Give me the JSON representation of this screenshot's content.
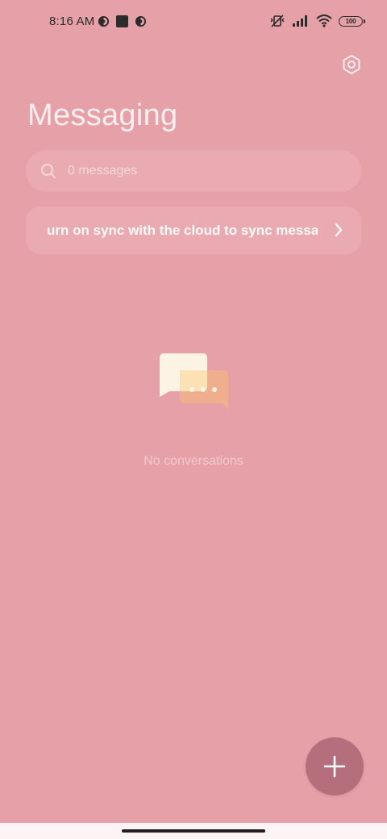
{
  "status_bar": {
    "time": "8:16 AM",
    "battery": "100",
    "icons_left": [
      "app-notification-icon",
      "square-notification-icon",
      "app-notification-icon"
    ],
    "icons_right": [
      "vibrate-off-icon",
      "signal-icon",
      "wifi-icon",
      "battery-icon"
    ]
  },
  "header": {
    "title": "Messaging",
    "settings_icon": "settings-hexagon-icon"
  },
  "search": {
    "placeholder": "0 messages",
    "icon": "search-icon"
  },
  "sync_banner": {
    "text": "urn on sync with the cloud to sync messag",
    "icon": "chevron-right-icon"
  },
  "empty_state": {
    "text": "No conversations",
    "icon": "chat-bubbles-icon"
  },
  "fab": {
    "icon": "plus-icon"
  },
  "colors": {
    "background": "#e6a0a8",
    "card": "#eaaab1",
    "fab": "#b46e7c",
    "nav_bar": "#fcf3f4"
  }
}
